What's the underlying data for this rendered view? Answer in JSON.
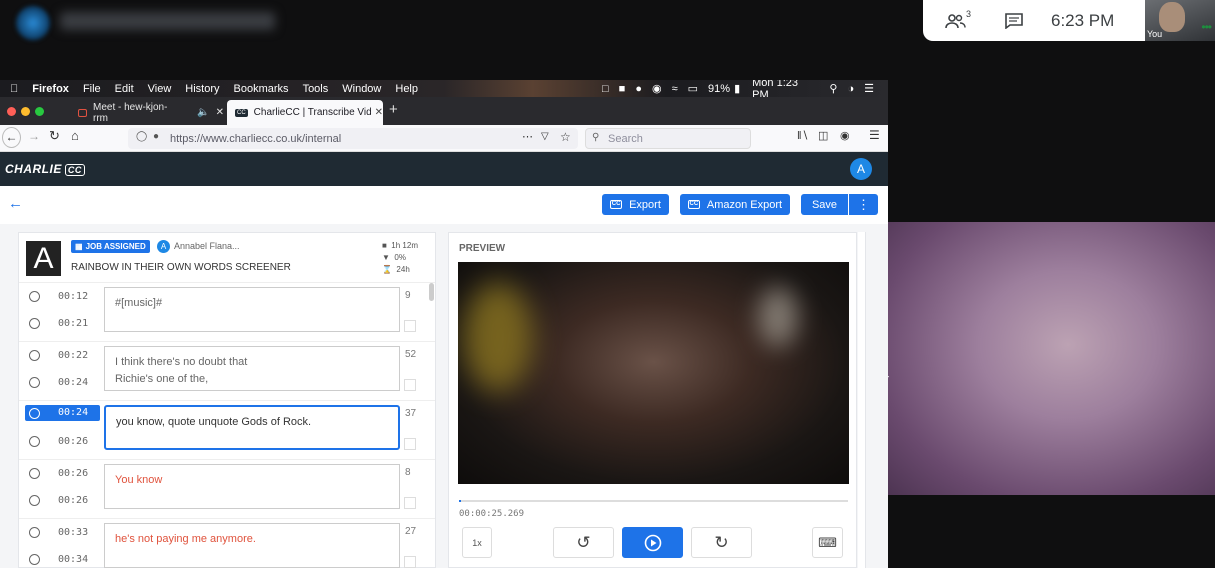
{
  "meet": {
    "participant_count": "3",
    "time": "6:23 PM",
    "self_label": "You"
  },
  "mac_menu": {
    "items": [
      "Firefox",
      "File",
      "Edit",
      "View",
      "History",
      "Bookmarks",
      "Tools",
      "Window",
      "Help"
    ],
    "battery": "91%",
    "clock": "Mon 1:23 PM"
  },
  "browser": {
    "tabs": [
      {
        "label": "Meet - hew-kjon-rrm"
      },
      {
        "label": "CharlieCC | Transcribe Video to"
      }
    ],
    "url": "https://www.charliecc.co.uk/internal",
    "url_domain": "charliecc.co.uk",
    "search_placeholder": "Search"
  },
  "app": {
    "brand": "CHARLIE",
    "brand_cc": "CC",
    "avatar_initial": "A",
    "toolbar": {
      "export_label": "Export",
      "amazon_export_label": "Amazon Export",
      "save_label": "Save",
      "cc_icon": "CC"
    },
    "job": {
      "thumb_letter": "A",
      "status": "JOB ASSIGNED",
      "assignee_initial": "A",
      "assignee": "Annabel Flana...",
      "title": "RAINBOW IN THEIR OWN WORDS SCREENER",
      "duration": "1h 12m",
      "progress": "0%",
      "turnaround": "24h"
    },
    "segments": [
      {
        "start": "00:12",
        "end": "00:21",
        "text": "#[music]#",
        "chars": "9",
        "active": false
      },
      {
        "start": "00:22",
        "end": "00:24",
        "text": "I think there's no doubt that\nRichie's one of the,",
        "chars": "52",
        "active": false
      },
      {
        "start": "00:24",
        "end": "00:26",
        "text": "you know, quote unquote Gods of Rock.",
        "chars": "37",
        "active": true
      },
      {
        "start": "00:26",
        "end": "00:26",
        "text": "You know",
        "chars": "8",
        "active": false
      },
      {
        "start": "00:33",
        "end": "00:34",
        "text": "he's not paying me anymore.",
        "chars": "27",
        "active": false
      }
    ],
    "preview": {
      "label": "PREVIEW",
      "timecode": "00:00:25.269",
      "speed": "1x",
      "progress_fraction": 0.005
    }
  },
  "colors": {
    "accent": "#1e73e8",
    "nav_bg": "#1f2a33",
    "error_text": "#e0533d"
  }
}
